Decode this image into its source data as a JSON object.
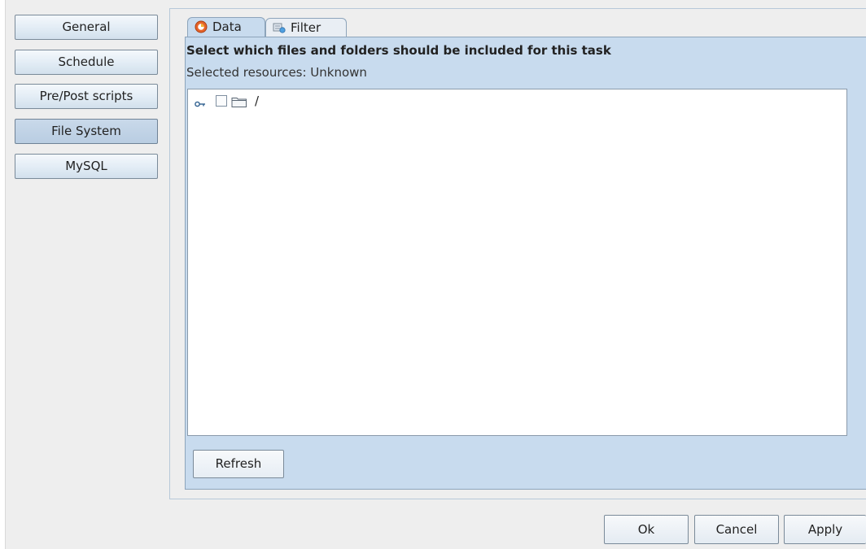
{
  "sidebar": {
    "items": [
      {
        "label": "General"
      },
      {
        "label": "Schedule"
      },
      {
        "label": "Pre/Post scripts"
      },
      {
        "label": "File System",
        "active": true
      },
      {
        "label": "MySQL"
      }
    ]
  },
  "tabs": [
    {
      "label": "Data",
      "icon": "data-icon",
      "selected": true
    },
    {
      "label": "Filter",
      "icon": "filter-icon",
      "selected": false
    }
  ],
  "data_panel": {
    "heading": "Select which files and folders should be included for this task",
    "selected_resources": "Selected resources: Unknown",
    "tree": {
      "root": {
        "label": "/",
        "checked": false,
        "expander_icon": "key-icon",
        "icon": "folder-icon"
      }
    },
    "refresh_label": "Refresh"
  },
  "footer": {
    "ok_label": "Ok",
    "cancel_label": "Cancel",
    "apply_label": "Apply"
  },
  "colors": {
    "panel": "#c8dbee",
    "active_nav": "#bcd0e5"
  }
}
